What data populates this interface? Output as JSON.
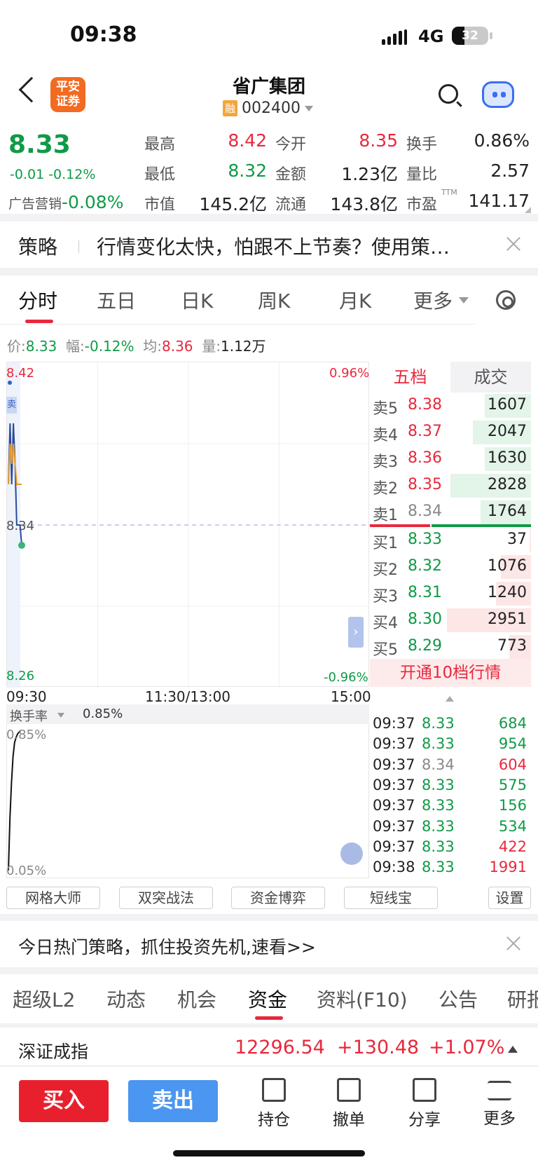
{
  "status": {
    "time": "09:38",
    "network": "4G",
    "battery": "32"
  },
  "header": {
    "broker_logo": "平安证券",
    "title": "省广集团",
    "margin_tag": "融",
    "code": "002400"
  },
  "quote": {
    "price": "8.33",
    "change": "-0.01  -0.12%",
    "industry": {
      "label": "广告营销",
      "value": "-0.08%"
    },
    "fields": [
      {
        "label": "最高",
        "value": "8.42",
        "color": "red"
      },
      {
        "label": "今开",
        "value": "8.35",
        "color": "red"
      },
      {
        "label": "换手",
        "value": "0.86%",
        "color": "dark"
      },
      {
        "label": "最低",
        "value": "8.32",
        "color": "green"
      },
      {
        "label": "金额",
        "value": "1.23亿",
        "color": "dark"
      },
      {
        "label": "量比",
        "value": "2.57",
        "color": "dark"
      },
      {
        "label": "市值",
        "value": "145.2亿",
        "color": "dark"
      },
      {
        "label": "流通",
        "value": "143.8亿",
        "color": "dark"
      },
      {
        "label": "市盈",
        "value": "141.17",
        "color": "dark",
        "sup": "TTM"
      }
    ]
  },
  "strategy_banner": {
    "tag": "策略",
    "text": "行情变化太快，怕跟不上节奏？使用策…"
  },
  "chart_tabs": [
    "分时",
    "五日",
    "日K",
    "周K",
    "月K",
    "更多"
  ],
  "info_bar": {
    "price_label": "价:",
    "price": "8.33",
    "amp_label": "幅:",
    "amp": "-0.12%",
    "avg_label": "均:",
    "avg": "8.36",
    "vol_label": "量:",
    "vol": "1.12万"
  },
  "chart_labels": {
    "y_top": "8.42",
    "y_mid": "8.34",
    "y_bottom": "8.26",
    "pct_top": "0.96%",
    "pct_bottom": "-0.96%",
    "sell_tag": "卖",
    "time_start": "09:30",
    "time_mid": "11:30/13:00",
    "time_end": "15:00"
  },
  "chart_data": {
    "type": "line",
    "title": "",
    "x": [
      "09:30",
      "09:31",
      "09:32",
      "09:33",
      "09:34",
      "09:35",
      "09:36",
      "09:37",
      "09:38"
    ],
    "series": [
      {
        "values": [
          8.36,
          8.39,
          8.36,
          8.39,
          8.37,
          8.34,
          8.34,
          8.34,
          8.33
        ],
        "color": "#2a4a9a"
      },
      {
        "values": [
          8.36,
          8.38,
          8.37,
          8.38,
          8.37,
          8.36,
          8.36,
          8.36,
          8.36
        ],
        "color": "#e89a2a"
      }
    ],
    "ylim": [
      8.26,
      8.42
    ],
    "prev_close": 8.34
  },
  "turnover": {
    "label": "换手率",
    "value": "0.85%",
    "y_top": "0.85%",
    "y_bottom": "0.05%"
  },
  "turnover_data": {
    "type": "line",
    "values": [
      0.05,
      0.35,
      0.55,
      0.7,
      0.78,
      0.81,
      0.83,
      0.84,
      0.85
    ],
    "ylim": [
      0.05,
      0.85
    ]
  },
  "order_book": {
    "tab1": "五档",
    "tab2": "成交",
    "asks": [
      {
        "label": "卖5",
        "price": "8.38",
        "vol": "1607",
        "pcolor": "red",
        "fill": 0.55
      },
      {
        "label": "卖4",
        "price": "8.37",
        "vol": "2047",
        "pcolor": "red",
        "fill": 0.69
      },
      {
        "label": "卖3",
        "price": "8.36",
        "vol": "1630",
        "pcolor": "red",
        "fill": 0.55
      },
      {
        "label": "卖2",
        "price": "8.35",
        "vol": "2828",
        "pcolor": "red",
        "fill": 0.96
      },
      {
        "label": "卖1",
        "price": "8.34",
        "vol": "1764",
        "pcolor": "gray",
        "fill": 0.6
      }
    ],
    "bids": [
      {
        "label": "买1",
        "price": "8.33",
        "vol": "37",
        "pcolor": "green",
        "fill": 0.02
      },
      {
        "label": "买2",
        "price": "8.32",
        "vol": "1076",
        "pcolor": "green",
        "fill": 0.36
      },
      {
        "label": "买3",
        "price": "8.31",
        "vol": "1240",
        "pcolor": "green",
        "fill": 0.42
      },
      {
        "label": "买4",
        "price": "8.30",
        "vol": "2951",
        "pcolor": "green",
        "fill": 1.0
      },
      {
        "label": "买5",
        "price": "8.29",
        "vol": "773",
        "pcolor": "green",
        "fill": 0.26
      }
    ],
    "upgrade": "开通10档行情"
  },
  "trades": [
    {
      "time": "09:37",
      "price": "8.33",
      "vol": "684",
      "pcolor": "green",
      "vcolor": "green"
    },
    {
      "time": "09:37",
      "price": "8.33",
      "vol": "954",
      "pcolor": "green",
      "vcolor": "green"
    },
    {
      "time": "09:37",
      "price": "8.34",
      "vol": "604",
      "pcolor": "gray",
      "vcolor": "red"
    },
    {
      "time": "09:37",
      "price": "8.33",
      "vol": "575",
      "pcolor": "green",
      "vcolor": "green"
    },
    {
      "time": "09:37",
      "price": "8.33",
      "vol": "156",
      "pcolor": "green",
      "vcolor": "green"
    },
    {
      "time": "09:37",
      "price": "8.33",
      "vol": "534",
      "pcolor": "green",
      "vcolor": "green"
    },
    {
      "time": "09:37",
      "price": "8.33",
      "vol": "422",
      "pcolor": "green",
      "vcolor": "red"
    },
    {
      "time": "09:38",
      "price": "8.33",
      "vol": "1991",
      "pcolor": "green",
      "vcolor": "red"
    }
  ],
  "strategy_buttons": [
    "网格大师",
    "双突战法",
    "资金博弈",
    "短线宝",
    "设置"
  ],
  "hot_banner": "今日热门策略，抓住投资先机,速看>>",
  "bottom_tabs": [
    "超级L2",
    "动态",
    "机会",
    "资金",
    "资料(F10)",
    "公告",
    "研报"
  ],
  "index": {
    "name": "深证成指",
    "price": "12296.54",
    "change": "+130.48",
    "pct": "+1.07%"
  },
  "actions": {
    "buy": "买入",
    "sell": "卖出",
    "items": [
      "持仓",
      "撤单",
      "分享",
      "更多"
    ]
  },
  "colors": {
    "red": "#e8283d",
    "green": "#0f9a47",
    "gray": "#888888",
    "dark": "#222222",
    "accent": "#4b96f0"
  }
}
